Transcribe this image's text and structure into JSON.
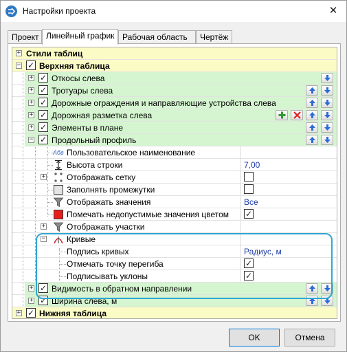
{
  "window": {
    "title": "Настройки проекта",
    "close_glyph": "✕"
  },
  "tabs": [
    {
      "label": "Проект"
    },
    {
      "label": "Линейный график"
    },
    {
      "label": "Рабочая область"
    },
    {
      "label": "Чертёж"
    }
  ],
  "tree": {
    "table_styles": "Стили таблиц",
    "top_table": "Верхняя таблица",
    "slopes_left": "Откосы слева",
    "sidewalks_left": "Тротуары слева",
    "road_barriers_left": "Дорожные ограждения и направляющие устройства слева",
    "road_marking_left": "Дорожная разметка слева",
    "plan_elements": "Элементы в плане",
    "long_profile": "Продольный профиль",
    "custom_name": "Пользовательское наименование",
    "custom_name_icon_text": "Абв",
    "row_height": "Высота строки",
    "row_height_value": "7,00",
    "show_grid": "Отображать сетку",
    "fill_gaps": "Заполнять промежутки",
    "show_values": "Отображать значения",
    "show_values_value": "Все",
    "mark_invalid": "Помечать недопустимые значения цветом",
    "show_sections": "Отображать участки",
    "curves": "Кривые",
    "curve_label": "Подпись кривых",
    "curve_label_value": "Радиус, м",
    "mark_inflection": "Отмечать точку перегиба",
    "sign_slopes": "Подписывать уклоны",
    "reverse_visibility": "Видимость в обратном направлении",
    "width_left": "Ширина слева, м",
    "bottom_table": "Нижняя таблица"
  },
  "buttons": {
    "ok": "OK",
    "cancel": "Отмена"
  },
  "colors": {
    "yellow_row": "#fbfbc6",
    "green_row": "#d5f5d0",
    "value_text": "#1c3aa6",
    "highlight": "#2ea6d2",
    "arrow": "#2b6cd4"
  },
  "icons": [
    "app-settings-icon",
    "close-icon",
    "expand-plus-icon",
    "collapse-minus-icon",
    "checkbox-icon",
    "arrow-up-icon",
    "arrow-down-icon",
    "add-plus-icon",
    "delete-x-icon",
    "text-abc-icon",
    "row-height-icon",
    "grid-icon",
    "fill-square-icon",
    "filter-funnel-icon",
    "red-square-icon",
    "curve-icon"
  ]
}
